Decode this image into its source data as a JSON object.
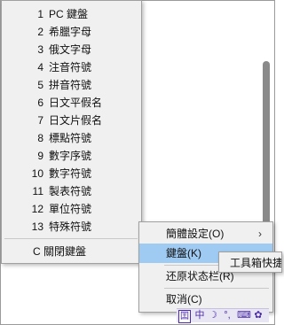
{
  "keyboard_menu": {
    "items": [
      {
        "num": "1",
        "label": "PC 鍵盤"
      },
      {
        "num": "2",
        "label": "希臘字母"
      },
      {
        "num": "3",
        "label": "俄文字母"
      },
      {
        "num": "4",
        "label": "注音符號"
      },
      {
        "num": "5",
        "label": "拼音符號"
      },
      {
        "num": "6",
        "label": "日文平假名"
      },
      {
        "num": "7",
        "label": "日文片假名"
      },
      {
        "num": "8",
        "label": "標點符號"
      },
      {
        "num": "9",
        "label": "數字序號"
      },
      {
        "num": "10",
        "label": "數字符號"
      },
      {
        "num": "11",
        "label": "製表符號"
      },
      {
        "num": "12",
        "label": "單位符號"
      },
      {
        "num": "13",
        "label": "特殊符號"
      }
    ],
    "close_label": "C 關閉鍵盤"
  },
  "context_menu": {
    "items": [
      {
        "label": "簡體設定(O)",
        "submenu": true
      },
      {
        "label": "鍵盤(K)",
        "active": true
      },
      {
        "label": "还原状态栏(R)"
      },
      {
        "label": "取消(C)"
      }
    ],
    "arrow_glyph": "›"
  },
  "submenu": {
    "label": "工具箱快捷"
  },
  "ime_toolbar": {
    "buttons": [
      "囯",
      "中",
      "☽",
      "°,",
      "⌨",
      "✿"
    ],
    "accent": "#4b2aa8"
  }
}
